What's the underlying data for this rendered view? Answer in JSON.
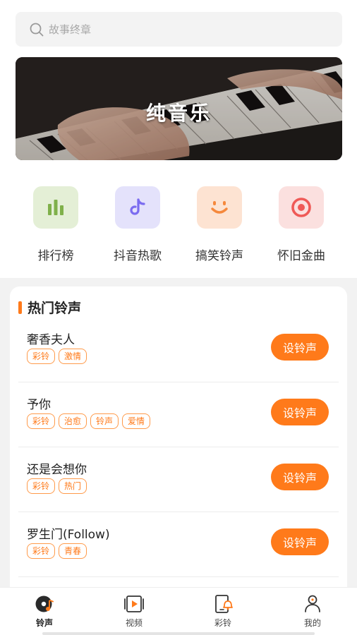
{
  "search": {
    "placeholder": "故事终章"
  },
  "banner": {
    "title": "纯音乐"
  },
  "categories": [
    {
      "label": "排行榜",
      "icon": "bar-chart-icon",
      "bg": "#e4efd6",
      "fg": "#7fb04a"
    },
    {
      "label": "抖音热歌",
      "icon": "tiktok-note-icon",
      "bg": "#e4e2fb",
      "fg": "#7b6cf0"
    },
    {
      "label": "搞笑铃声",
      "icon": "smile-icon",
      "bg": "#fde3d2",
      "fg": "#f5883c"
    },
    {
      "label": "怀旧金曲",
      "icon": "target-icon",
      "bg": "#fbe0df",
      "fg": "#ef5a57"
    }
  ],
  "hot": {
    "title": "热门铃声",
    "button_label": "设铃声",
    "songs": [
      {
        "name": "奢香夫人",
        "tags": [
          "彩铃",
          "激情"
        ]
      },
      {
        "name": "予你",
        "tags": [
          "彩铃",
          "治愈",
          "铃声",
          "爱情"
        ]
      },
      {
        "name": "还是会想你",
        "tags": [
          "彩铃",
          "热门"
        ]
      },
      {
        "name": "罗生门(Follow)",
        "tags": [
          "彩铃",
          "青春"
        ]
      }
    ]
  },
  "tabbar": {
    "active": 0,
    "items": [
      {
        "label": "铃声",
        "icon": "ringtone-disc-icon"
      },
      {
        "label": "视频",
        "icon": "video-play-icon"
      },
      {
        "label": "彩铃",
        "icon": "phone-bell-icon"
      },
      {
        "label": "我的",
        "icon": "user-icon"
      }
    ]
  },
  "colors": {
    "accent": "#ff7a1a"
  }
}
